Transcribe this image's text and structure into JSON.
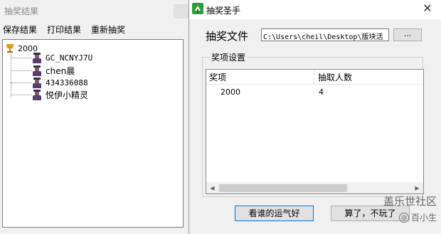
{
  "back_window": {
    "title": "抽奖结果",
    "menu": [
      "保存结果",
      "打印结果",
      "重新抽奖"
    ],
    "tree": {
      "root": "2000",
      "children": [
        "GC_NCNYJ7U",
        "chen晨",
        "434336088",
        "悦伊小精灵"
      ]
    }
  },
  "front_window": {
    "title": "抽奖圣手",
    "file_label": "抽奖文件",
    "file_path": "C:\\Users\\cheil\\Desktop\\版块活",
    "browse_label": "...",
    "group_title": "奖项设置",
    "list": {
      "columns": [
        "奖项",
        "抽取人数"
      ],
      "rows": [
        [
          "2000",
          "4"
        ]
      ]
    },
    "buttons": {
      "lucky": "看谁的运气好",
      "forget": "算了，不玩了"
    }
  },
  "watermark": {
    "line1": "盖乐世社区",
    "line2": "百小生",
    "at": "@"
  },
  "colors": {
    "focus_border": "#0078d7",
    "button_face": "#e1e1e1",
    "window_bg": "#f0f0f0"
  }
}
